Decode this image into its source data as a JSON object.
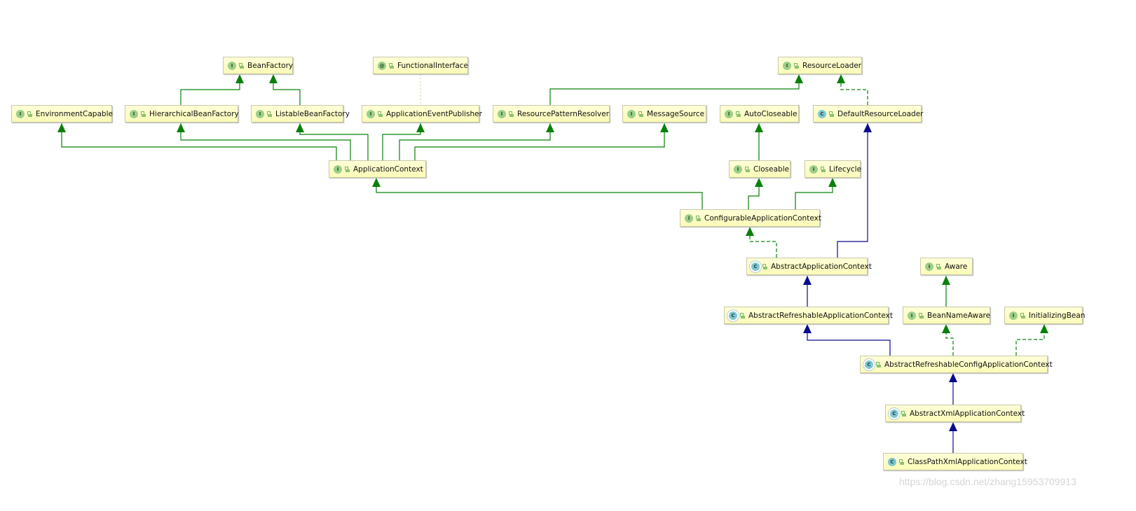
{
  "colors": {
    "interface_edge": "#0a800a",
    "class_edge": "#0a0a8c",
    "node_fill": "#ffffc8",
    "annotation_edge": "#c8d8a0"
  },
  "nodes": [
    {
      "id": "BeanFactory",
      "kind": "interface",
      "badge": "I",
      "label": "BeanFactory"
    },
    {
      "id": "FunctionalInterface",
      "kind": "annotation",
      "badge": "@",
      "label": "FunctionalInterface"
    },
    {
      "id": "ResourceLoader",
      "kind": "interface",
      "badge": "I",
      "label": "ResourceLoader"
    },
    {
      "id": "EnvironmentCapable",
      "kind": "interface",
      "badge": "I",
      "label": "EnvironmentCapable"
    },
    {
      "id": "HierarchicalBeanFactory",
      "kind": "interface",
      "badge": "I",
      "label": "HierarchicalBeanFactory"
    },
    {
      "id": "ListableBeanFactory",
      "kind": "interface",
      "badge": "I",
      "label": "ListableBeanFactory"
    },
    {
      "id": "ApplicationEventPublisher",
      "kind": "interface",
      "badge": "I",
      "label": "ApplicationEventPublisher"
    },
    {
      "id": "ResourcePatternResolver",
      "kind": "interface",
      "badge": "I",
      "label": "ResourcePatternResolver"
    },
    {
      "id": "MessageSource",
      "kind": "interface",
      "badge": "I",
      "label": "MessageSource"
    },
    {
      "id": "AutoCloseable",
      "kind": "interface",
      "badge": "I",
      "label": "AutoCloseable"
    },
    {
      "id": "DefaultResourceLoader",
      "kind": "class",
      "badge": "C",
      "label": "DefaultResourceLoader"
    },
    {
      "id": "ApplicationContext",
      "kind": "interface",
      "badge": "I",
      "label": "ApplicationContext"
    },
    {
      "id": "Closeable",
      "kind": "interface",
      "badge": "I",
      "label": "Closeable"
    },
    {
      "id": "Lifecycle",
      "kind": "interface",
      "badge": "I",
      "label": "Lifecycle"
    },
    {
      "id": "ConfigurableApplicationContext",
      "kind": "interface",
      "badge": "I",
      "label": "ConfigurableApplicationContext"
    },
    {
      "id": "AbstractApplicationContext",
      "kind": "abstract",
      "badge": "C",
      "label": "AbstractApplicationContext"
    },
    {
      "id": "Aware",
      "kind": "interface",
      "badge": "I",
      "label": "Aware"
    },
    {
      "id": "AbstractRefreshableApplicationContext",
      "kind": "abstract",
      "badge": "C",
      "label": "AbstractRefreshableApplicationContext"
    },
    {
      "id": "BeanNameAware",
      "kind": "interface",
      "badge": "I",
      "label": "BeanNameAware"
    },
    {
      "id": "InitializingBean",
      "kind": "interface",
      "badge": "I",
      "label": "InitializingBean"
    },
    {
      "id": "AbstractRefreshableConfigApplicationContext",
      "kind": "abstract",
      "badge": "C",
      "label": "AbstractRefreshableConfigApplicationContext"
    },
    {
      "id": "AbstractXmlApplicationContext",
      "kind": "abstract",
      "badge": "C",
      "label": "AbstractXmlApplicationContext"
    },
    {
      "id": "ClassPathXmlApplicationContext",
      "kind": "class",
      "badge": "C",
      "label": "ClassPathXmlApplicationContext"
    }
  ],
  "edges": [
    {
      "from": "HierarchicalBeanFactory",
      "to": "BeanFactory",
      "type": "extends-interface"
    },
    {
      "from": "ListableBeanFactory",
      "to": "BeanFactory",
      "type": "extends-interface"
    },
    {
      "from": "FunctionalInterface",
      "to": "ApplicationEventPublisher",
      "type": "annotation"
    },
    {
      "from": "ApplicationContext",
      "to": "EnvironmentCapable",
      "type": "extends-interface"
    },
    {
      "from": "ApplicationContext",
      "to": "HierarchicalBeanFactory",
      "type": "extends-interface"
    },
    {
      "from": "ApplicationContext",
      "to": "ListableBeanFactory",
      "type": "extends-interface"
    },
    {
      "from": "ApplicationContext",
      "to": "ApplicationEventPublisher",
      "type": "extends-interface"
    },
    {
      "from": "ApplicationContext",
      "to": "ResourcePatternResolver",
      "type": "extends-interface"
    },
    {
      "from": "ApplicationContext",
      "to": "MessageSource",
      "type": "extends-interface"
    },
    {
      "from": "ResourcePatternResolver",
      "to": "ResourceLoader",
      "type": "extends-interface"
    },
    {
      "from": "DefaultResourceLoader",
      "to": "ResourceLoader",
      "type": "implements"
    },
    {
      "from": "Closeable",
      "to": "AutoCloseable",
      "type": "extends-interface"
    },
    {
      "from": "ConfigurableApplicationContext",
      "to": "ApplicationContext",
      "type": "extends-interface"
    },
    {
      "from": "ConfigurableApplicationContext",
      "to": "Closeable",
      "type": "extends-interface"
    },
    {
      "from": "ConfigurableApplicationContext",
      "to": "Lifecycle",
      "type": "extends-interface"
    },
    {
      "from": "AbstractApplicationContext",
      "to": "ConfigurableApplicationContext",
      "type": "implements"
    },
    {
      "from": "AbstractApplicationContext",
      "to": "DefaultResourceLoader",
      "type": "extends-class"
    },
    {
      "from": "AbstractRefreshableApplicationContext",
      "to": "AbstractApplicationContext",
      "type": "extends-class"
    },
    {
      "from": "BeanNameAware",
      "to": "Aware",
      "type": "extends-interface"
    },
    {
      "from": "AbstractRefreshableConfigApplicationContext",
      "to": "AbstractRefreshableApplicationContext",
      "type": "extends-class"
    },
    {
      "from": "AbstractRefreshableConfigApplicationContext",
      "to": "BeanNameAware",
      "type": "implements"
    },
    {
      "from": "AbstractRefreshableConfigApplicationContext",
      "to": "InitializingBean",
      "type": "implements"
    },
    {
      "from": "AbstractXmlApplicationContext",
      "to": "AbstractRefreshableConfigApplicationContext",
      "type": "extends-class"
    },
    {
      "from": "ClassPathXmlApplicationContext",
      "to": "AbstractXmlApplicationContext",
      "type": "extends-class"
    }
  ],
  "watermark": "https://blog.csdn.net/zhang15953709913"
}
